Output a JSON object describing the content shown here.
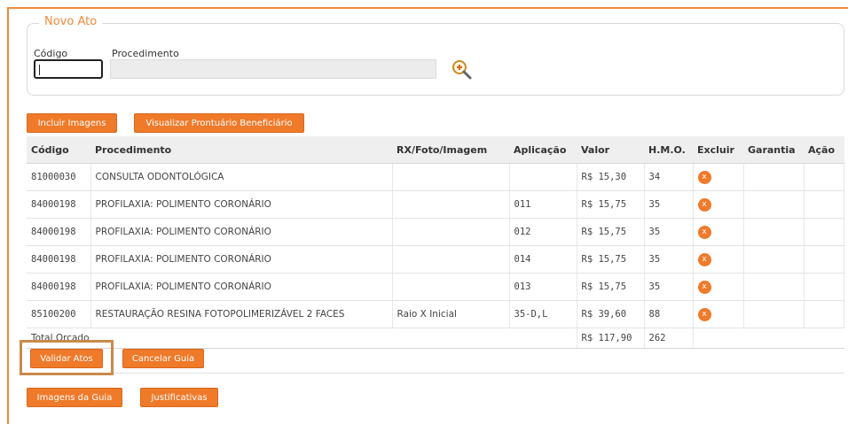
{
  "novo_ato": {
    "legend": "Novo Ato",
    "codigo_label": "Código",
    "codigo_value": "",
    "procedimento_label": "Procedimento",
    "procedimento_value": ""
  },
  "toolbar": {
    "incluir_imagens": "Incluir Imagens",
    "visualizar_prontuario": "Visualizar Prontuário Beneficiário"
  },
  "table": {
    "headers": [
      "Código",
      "Procedimento",
      "RX/Foto/Imagem",
      "Aplicação",
      "Valor",
      "H.M.O.",
      "Excluir",
      "Garantia",
      "Ação"
    ],
    "rows": [
      {
        "codigo": "81000030",
        "procedimento": "CONSULTA ODONTOLÓGICA",
        "rx": "",
        "aplicacao": "",
        "valor": "R$ 15,30",
        "hmo": "34"
      },
      {
        "codigo": "84000198",
        "procedimento": "PROFILAXIA: POLIMENTO CORONÁRIO",
        "rx": "",
        "aplicacao": "011",
        "valor": "R$ 15,75",
        "hmo": "35"
      },
      {
        "codigo": "84000198",
        "procedimento": "PROFILAXIA: POLIMENTO CORONÁRIO",
        "rx": "",
        "aplicacao": "012",
        "valor": "R$ 15,75",
        "hmo": "35"
      },
      {
        "codigo": "84000198",
        "procedimento": "PROFILAXIA: POLIMENTO CORONÁRIO",
        "rx": "",
        "aplicacao": "014",
        "valor": "R$ 15,75",
        "hmo": "35"
      },
      {
        "codigo": "84000198",
        "procedimento": "PROFILAXIA: POLIMENTO CORONÁRIO",
        "rx": "",
        "aplicacao": "013",
        "valor": "R$ 15,75",
        "hmo": "35"
      },
      {
        "codigo": "85100200",
        "procedimento": "RESTAURAÇÃO RESINA FOTOPOLIMERIZÁVEL 2 FACES",
        "rx": "Raio X Inicial",
        "aplicacao": "35-D,L",
        "valor": "R$ 39,60",
        "hmo": "88"
      }
    ],
    "delete_glyph": "x",
    "total_label": "Total Orçado",
    "total_valor": "R$ 117,90",
    "total_hmo": "262"
  },
  "actions": {
    "validar_atos": "Validar Atos",
    "cancelar_guia": "Cancelar Guia",
    "imagens_guia": "Imagens da Guia",
    "justificativas": "Justificativas"
  },
  "colors": {
    "accent": "#ef7a2a",
    "frame": "#f08a3c",
    "highlight": "#c98a4a"
  }
}
